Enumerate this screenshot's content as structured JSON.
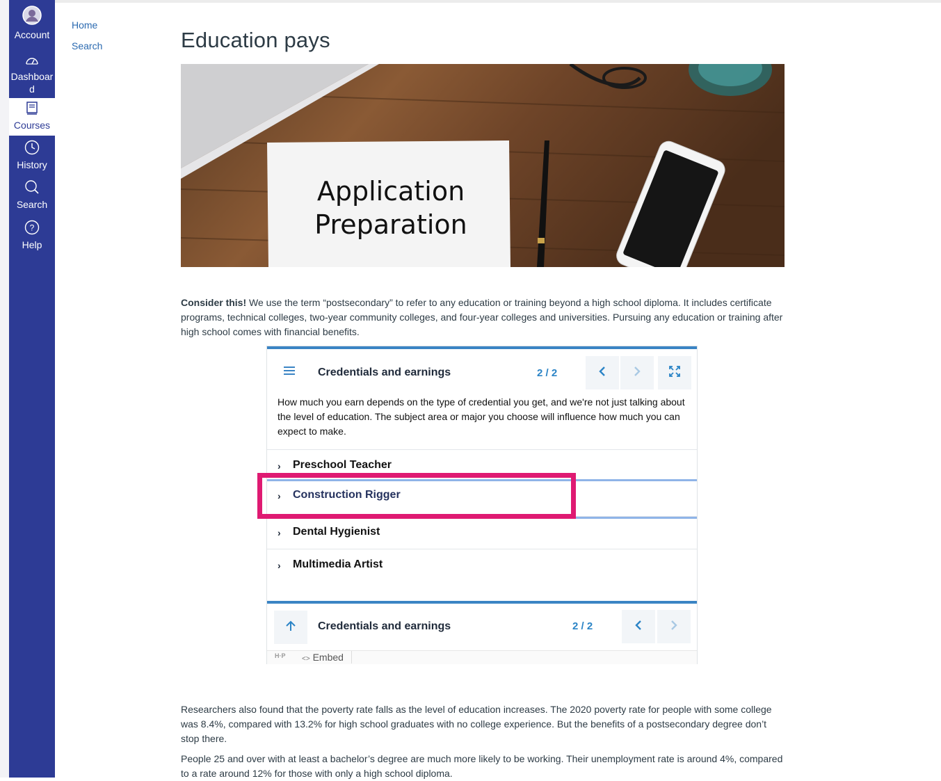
{
  "global_nav": [
    {
      "label": "Account",
      "icon": "account-avatar-icon"
    },
    {
      "label": "Dashboard",
      "icon": "dashboard-icon"
    },
    {
      "label": "Courses",
      "icon": "courses-icon",
      "active": true
    },
    {
      "label": "History",
      "icon": "history-clock-icon"
    },
    {
      "label": "Search",
      "icon": "search-icon"
    },
    {
      "label": "Help",
      "icon": "help-icon"
    }
  ],
  "course_nav": {
    "home": "Home",
    "search": "Search"
  },
  "page": {
    "title": "Education pays",
    "hero_caption_line1": "Application",
    "hero_caption_line2": "Preparation",
    "consider_bold": "Consider this!",
    "consider_text": " We use the term “postsecondary” to refer to any education or training beyond a high school diploma. It includes certificate programs, technical colleges, two-year community colleges, and four-year colleges and universities. Pursuing any education or training after high school comes with financial benefits.",
    "para2": "Researchers also found that the poverty rate falls as the level of education increases. The 2020 poverty rate for people with some college was 8.4%, compared with 13.2% for high school graduates with no college experience. But the benefits of a postsecondary degree don’t stop there.",
    "para3": "People 25 and over with at least a bachelor’s degree are much more likely to be working. Their unemployment rate is around 4%, compared to a rate around 12% for those with only a high school diploma."
  },
  "h5p": {
    "title": "Credentials and earnings",
    "page_indicator": "2 / 2",
    "intro": "How much you earn depends on the type of credential you get, and we're not just talking about the level of education. The subject area or major you choose will influence how much you can expect to make.",
    "items": [
      "Preschool Teacher",
      "Construction Rigger",
      "Dental Hygienist",
      "Multimedia Artist"
    ],
    "footer_title": "Credentials and earnings",
    "footer_page_indicator": "2 / 2",
    "logo": "H·P",
    "embed": "Embed",
    "accent": "#3a84c4"
  },
  "colors": {
    "nav_bg": "#2d3b95",
    "highlight": "#df1a72",
    "link": "#2b6ab0"
  }
}
